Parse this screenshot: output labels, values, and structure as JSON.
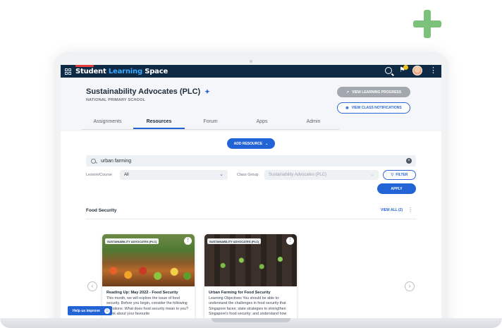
{
  "app": {
    "brand_primary": "Student",
    "brand_accent": "Learning",
    "brand_suffix": "Space"
  },
  "class_header": {
    "title": "Sustainability Advocates (PLC)",
    "school": "NATIONAL PRIMARY SCHOOL",
    "btn_progress": "VIEW LEARNING PROGRESS",
    "btn_notifications": "VIEW CLASS NOTIFICATIONS"
  },
  "tabs": [
    {
      "label": "Assignments",
      "active": false
    },
    {
      "label": "Resources",
      "active": true
    },
    {
      "label": "Forum",
      "active": false
    },
    {
      "label": "Apps",
      "active": false
    },
    {
      "label": "Admin",
      "active": false
    }
  ],
  "toolbar": {
    "add_resource": "ADD RESOURCE"
  },
  "search": {
    "value": "urban farming"
  },
  "filters": {
    "lesson_label": "Lesson/Course",
    "lesson_value": "All",
    "class_group_label": "Class Group",
    "class_group_value": "Sustainability Advocates (PLC)",
    "filter_label": "FILTER",
    "apply_label": "APPLY"
  },
  "section": {
    "title": "Food Security",
    "view_all": "VIEW ALL (2)"
  },
  "cards": [
    {
      "tag": "SUSTAINABILITY ADVOCATES (PLC)",
      "title": "Reading Up: May 2022 - Food Security",
      "desc": "This month, we will explore the issue of food security. Before you begin, consider the following questions: What does food security mean to you? Think about your favourite"
    },
    {
      "tag": "SUSTAINABILITY ADVOCATES (PLC)",
      "title": "Urban Farming for Food Security",
      "desc": "Learning Objectives You should be able to: understand the challenges in food security that Singapore faces; state strategies to strengthen Singapore's food security; and understand how"
    }
  ],
  "help": {
    "label": "Help us improve"
  },
  "colors": {
    "primary": "#2263d6",
    "topbar": "#0f2a44",
    "decor_plus": "#7cc27a"
  }
}
